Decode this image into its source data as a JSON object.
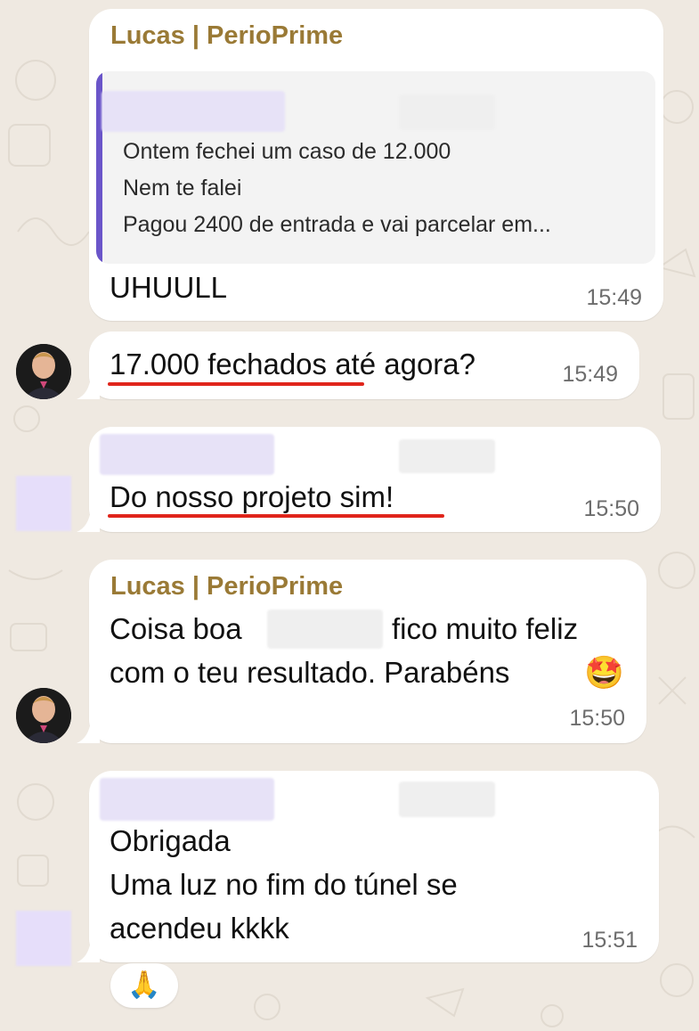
{
  "chat": {
    "messages": [
      {
        "sender": "Lucas | PerioPrime",
        "quoted_lines": [
          "Ontem fechei um caso de 12.000",
          "Nem te falei",
          "Pagou 2400 de entrada e vai parcelar em..."
        ],
        "text": "UHUULL",
        "time": "15:49"
      },
      {
        "text": "17.000 fechados até agora?",
        "time": "15:49"
      },
      {
        "text": "Do nosso projeto sim!",
        "time": "15:50"
      },
      {
        "sender": "Lucas | PerioPrime",
        "text_part1": "Coisa boa",
        "text_part2": "fico muito feliz",
        "text_line2": "com o teu resultado. Parabéns",
        "emoji": "🤩",
        "time": "15:50"
      },
      {
        "lines": [
          "Obrigada",
          "Uma luz no fim do túnel se",
          "acendeu kkkk"
        ],
        "time": "15:51",
        "reaction": "🙏"
      }
    ]
  },
  "colors": {
    "background": "#efe9e1",
    "bubble": "#ffffff",
    "sender_name": "#9a7a36",
    "quote_bar": "#6a55c9",
    "underline": "#e0251b"
  },
  "icons": {
    "reaction": "folded-hands-icon",
    "emoji": "star-struck-icon"
  }
}
